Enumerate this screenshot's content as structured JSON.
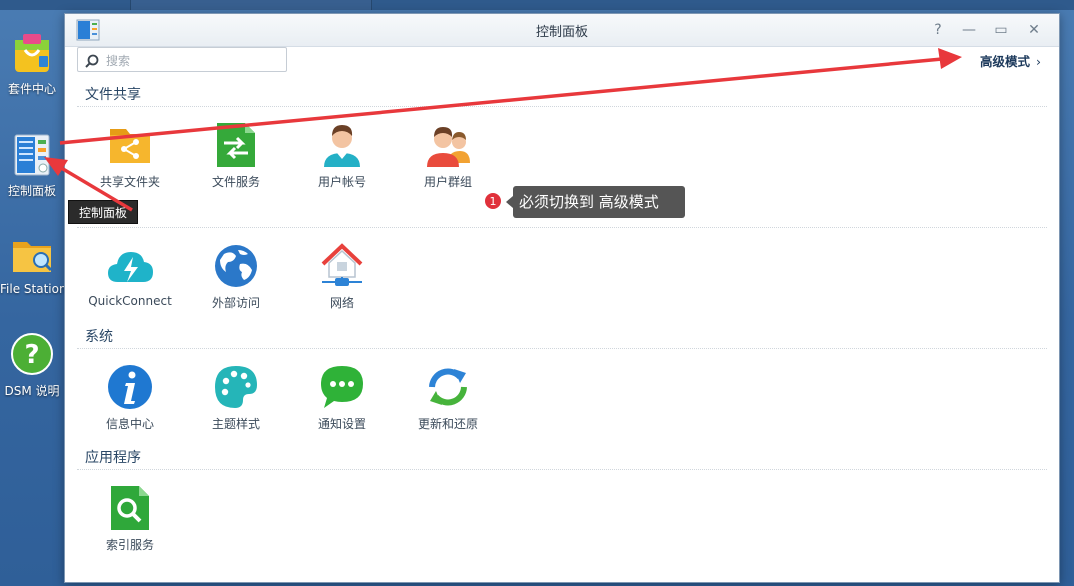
{
  "desktop": {
    "items": [
      {
        "label": "套件中心"
      },
      {
        "label": "控制面板"
      },
      {
        "label": "File Station"
      },
      {
        "label": "DSM 说明"
      }
    ]
  },
  "tooltip": {
    "text": "控制面板"
  },
  "window": {
    "title": "控制面板",
    "controls": {
      "help": "?",
      "minimize": "—",
      "maximize": "▭",
      "close": "✕"
    }
  },
  "search": {
    "placeholder": "搜索"
  },
  "advanced_mode": {
    "label": "高级模式",
    "chevron": "›"
  },
  "sections": [
    {
      "title": "文件共享",
      "items": [
        {
          "label": "共享文件夹",
          "icon": "shared-folder-icon"
        },
        {
          "label": "文件服务",
          "icon": "file-services-icon"
        },
        {
          "label": "用户帐号",
          "icon": "user-icon"
        },
        {
          "label": "用户群组",
          "icon": "group-icon"
        }
      ]
    },
    {
      "title": "",
      "items": [
        {
          "label": "QuickConnect",
          "icon": "quickconnect-icon"
        },
        {
          "label": "外部访问",
          "icon": "globe-icon"
        },
        {
          "label": "网络",
          "icon": "network-home-icon"
        }
      ]
    },
    {
      "title": "系统",
      "items": [
        {
          "label": "信息中心",
          "icon": "info-icon"
        },
        {
          "label": "主题样式",
          "icon": "palette-icon"
        },
        {
          "label": "通知设置",
          "icon": "chat-bubble-icon"
        },
        {
          "label": "更新和还原",
          "icon": "refresh-icon"
        }
      ]
    },
    {
      "title": "应用程序",
      "items": [
        {
          "label": "索引服务",
          "icon": "index-search-icon"
        }
      ]
    }
  ],
  "annotation": {
    "badge": "1",
    "text": "必须切换到  高级模式"
  },
  "colors": {
    "arrow": "#e8383c",
    "accent": "#1d3a5c"
  }
}
